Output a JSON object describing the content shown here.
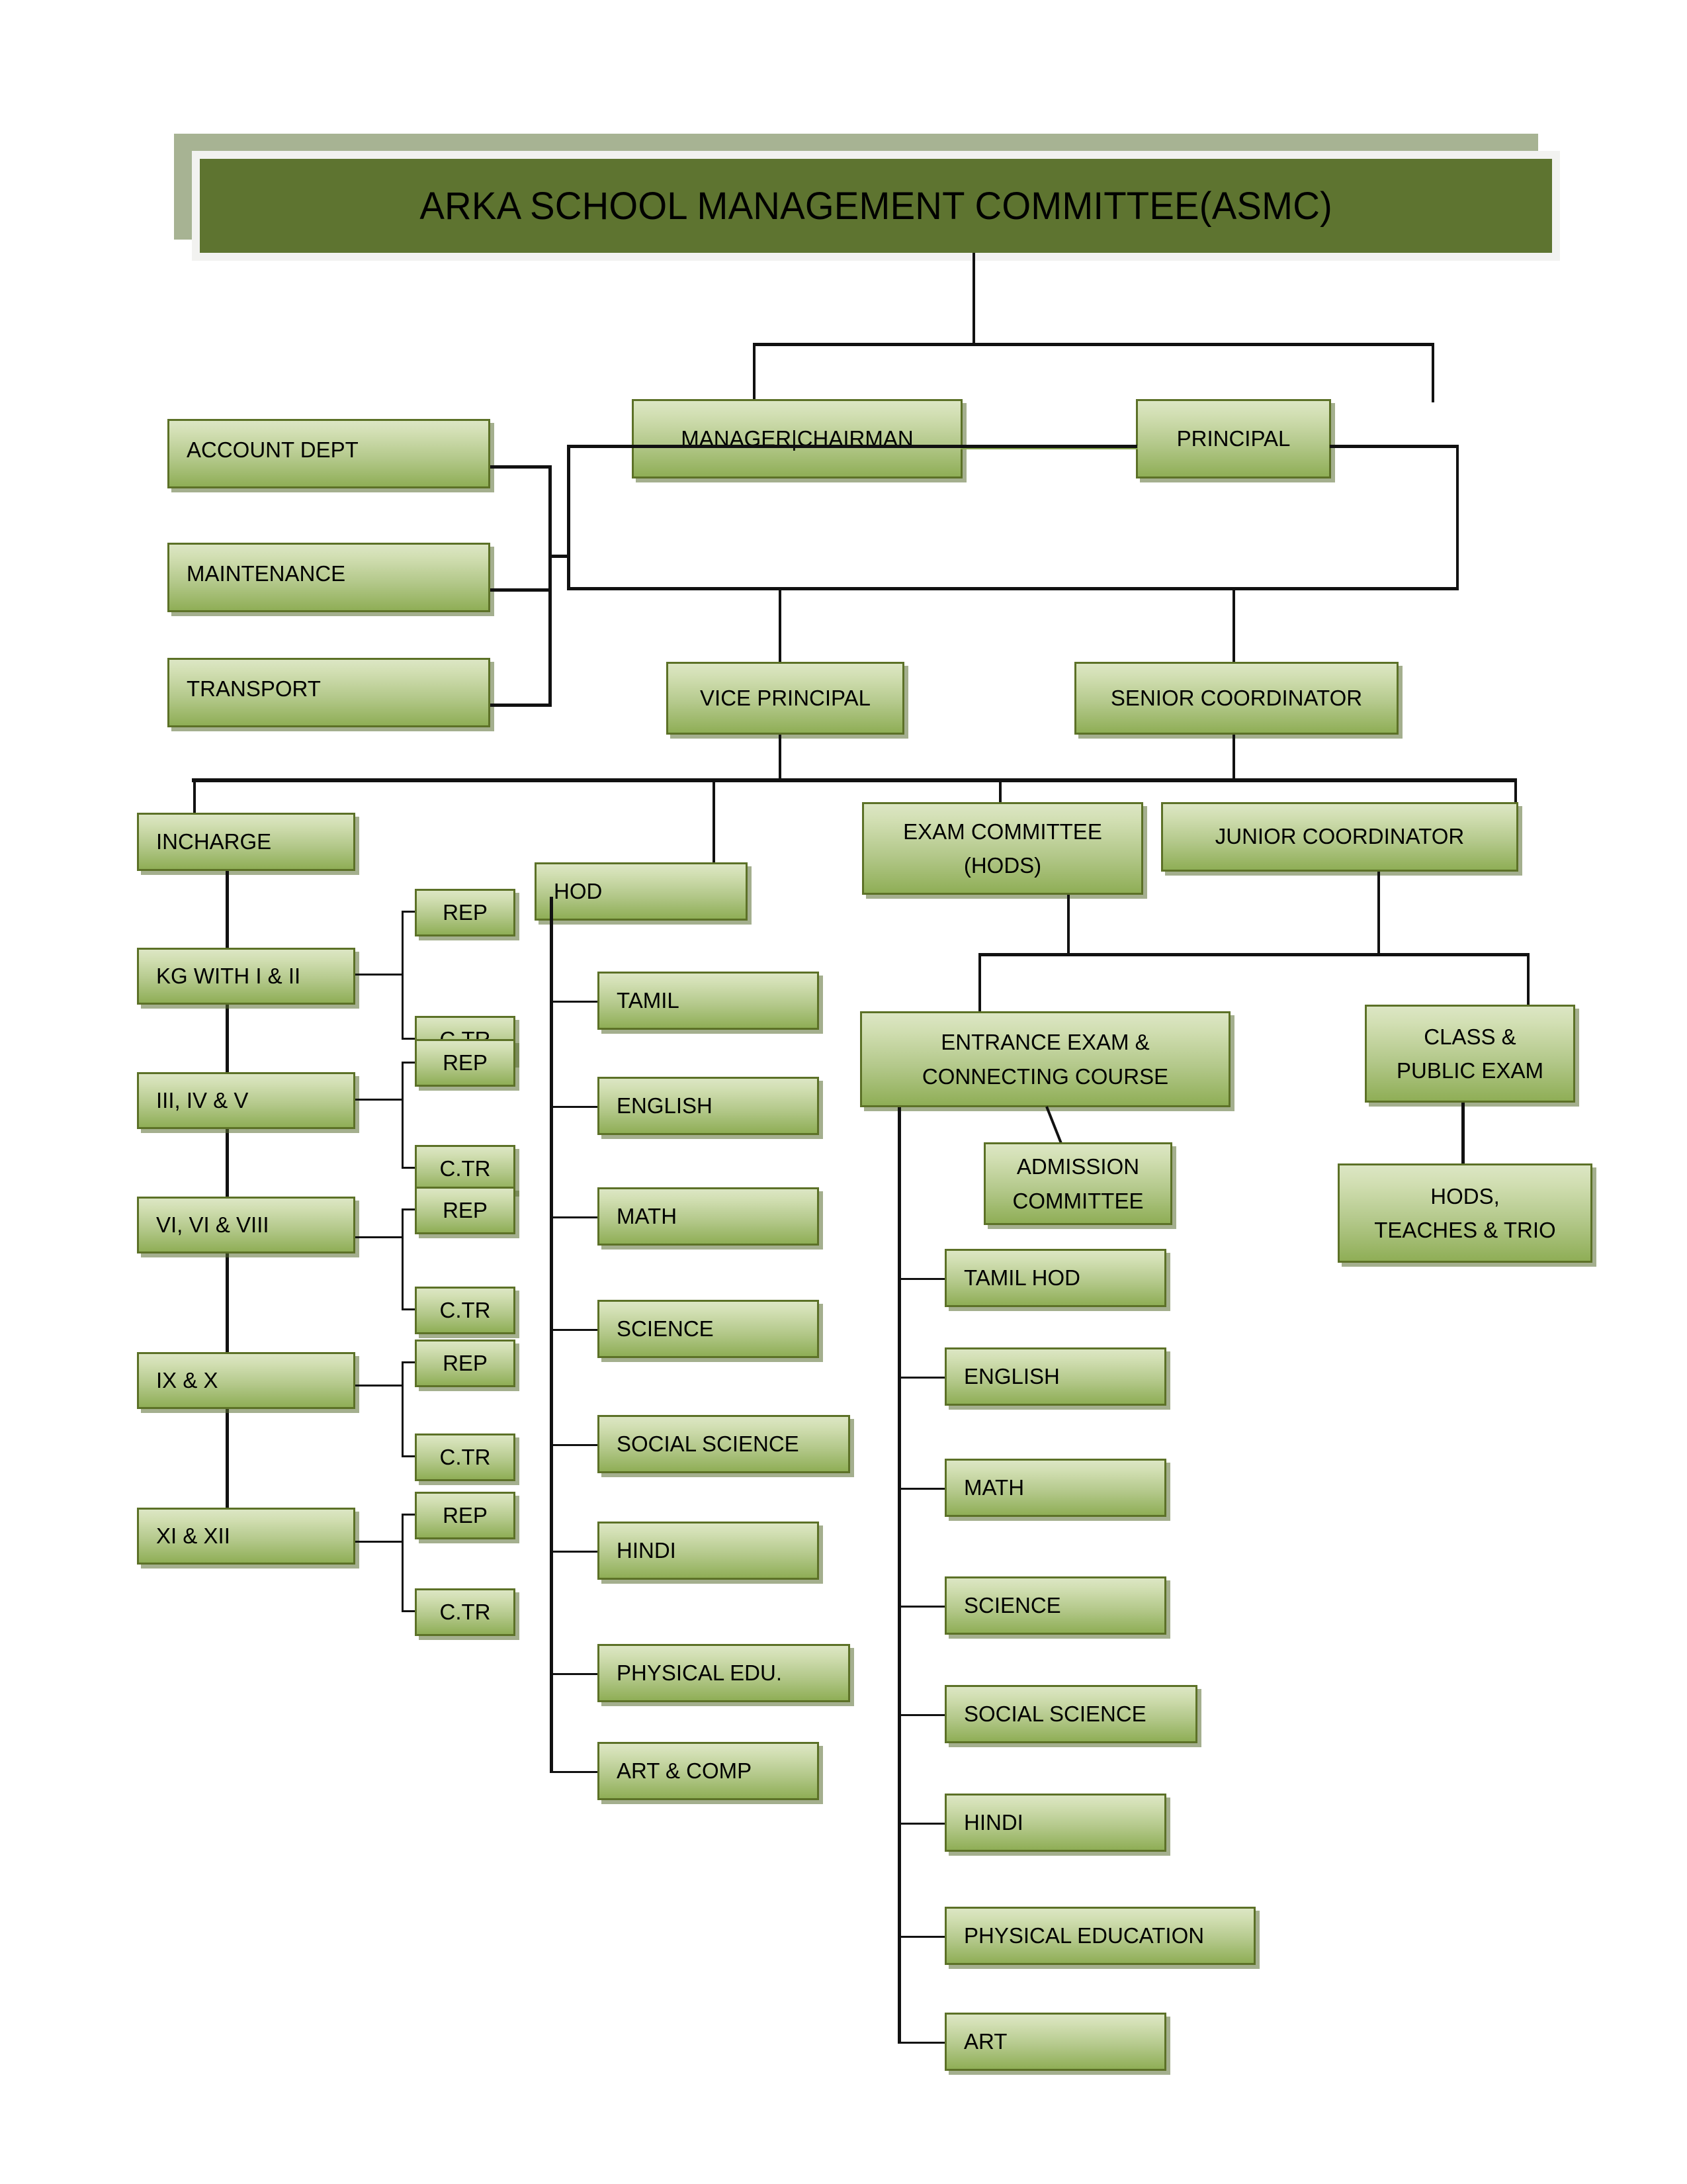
{
  "header": {
    "title": "ARKA SCHOOL MANAGEMENT COMMITTEE(ASMC)",
    "banner_color": "#5e7430",
    "plate_color": "#a7b393"
  },
  "theme": {
    "box_fill_top": "#dce6c4",
    "box_fill_bottom": "#8fae56",
    "box_border": "#5c7127",
    "connector_color": "#111111",
    "accent_link_color": "#8aa84f"
  },
  "nodes": {
    "manager_chairman": "MANAGER|CHAIRMAN",
    "principal": "PRINCIPAL",
    "vice_principal": "VICE PRINCIPAL",
    "senior_coordinator": "SENIOR COORDINATOR",
    "account_dept": "ACCOUNT DEPT",
    "maintenance": "MAINTENANCE",
    "transport": "TRANSPORT",
    "incharge": "INCHARGE",
    "hod": "HOD",
    "exam_committee": "EXAM COMMITTEE\n(HODS)",
    "exam_committee_line1": "EXAM COMMITTEE",
    "exam_committee_line2": "(HODS)",
    "junior_coordinator": "JUNIOR COORDINATOR",
    "entrance_exam_line1": "ENTRANCE EXAM &",
    "entrance_exam_line2": "CONNECTING COURSE",
    "class_public_exam_line1": "CLASS &",
    "class_public_exam_line2": "PUBLIC EXAM",
    "admission_committee_line1": "ADMISSION",
    "admission_committee_line2": "COMMITTEE",
    "hods_teachers_line1": "HODS,",
    "hods_teachers_line2": "TEACHES & TRIO"
  },
  "grades": [
    {
      "label": "KG WITH I & II",
      "rep": "REP",
      "ctr": "C.TR"
    },
    {
      "label": "III, IV & V",
      "rep": "REP",
      "ctr": "C.TR"
    },
    {
      "label": "VI, VI & VIII",
      "rep": "REP",
      "ctr": "C.TR"
    },
    {
      "label": "IX & X",
      "rep": "REP",
      "ctr": "C.TR"
    },
    {
      "label": "XI & XII",
      "rep": "REP",
      "ctr": "C.TR"
    }
  ],
  "hod_subjects": [
    "TAMIL",
    "ENGLISH",
    "MATH",
    "SCIENCE",
    "SOCIAL SCIENCE",
    "HINDI",
    "PHYSICAL EDU.",
    "ART & COMP"
  ],
  "exam_subjects": [
    "TAMIL HOD",
    "ENGLISH",
    "MATH",
    "SCIENCE",
    "SOCIAL SCIENCE",
    "HINDI",
    "PHYSICAL EDUCATION",
    "ART"
  ]
}
